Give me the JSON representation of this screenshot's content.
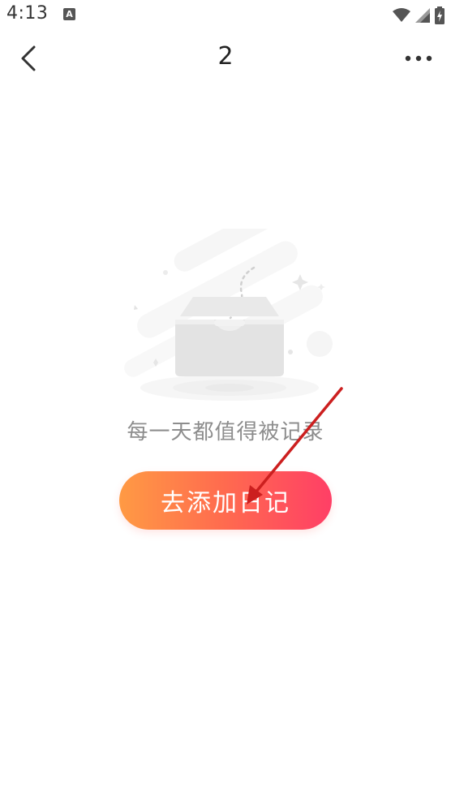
{
  "status_bar": {
    "time": "4:13",
    "notification_badge": "A",
    "icons": [
      "wifi-icon",
      "signal-icon",
      "battery-icon"
    ]
  },
  "nav": {
    "title": "2",
    "back_icon": "chevron-left-icon",
    "more_icon": "more-horizontal-icon"
  },
  "empty_state": {
    "illustration": "empty-box-illustration",
    "message": "每一天都值得被记录",
    "button_label": "去添加日记"
  },
  "colors": {
    "button_gradient_start": "#ff9a44",
    "button_gradient_end": "#ff3f66",
    "message_text": "#8d8d8d",
    "annotation_arrow": "#cc1f1f"
  }
}
